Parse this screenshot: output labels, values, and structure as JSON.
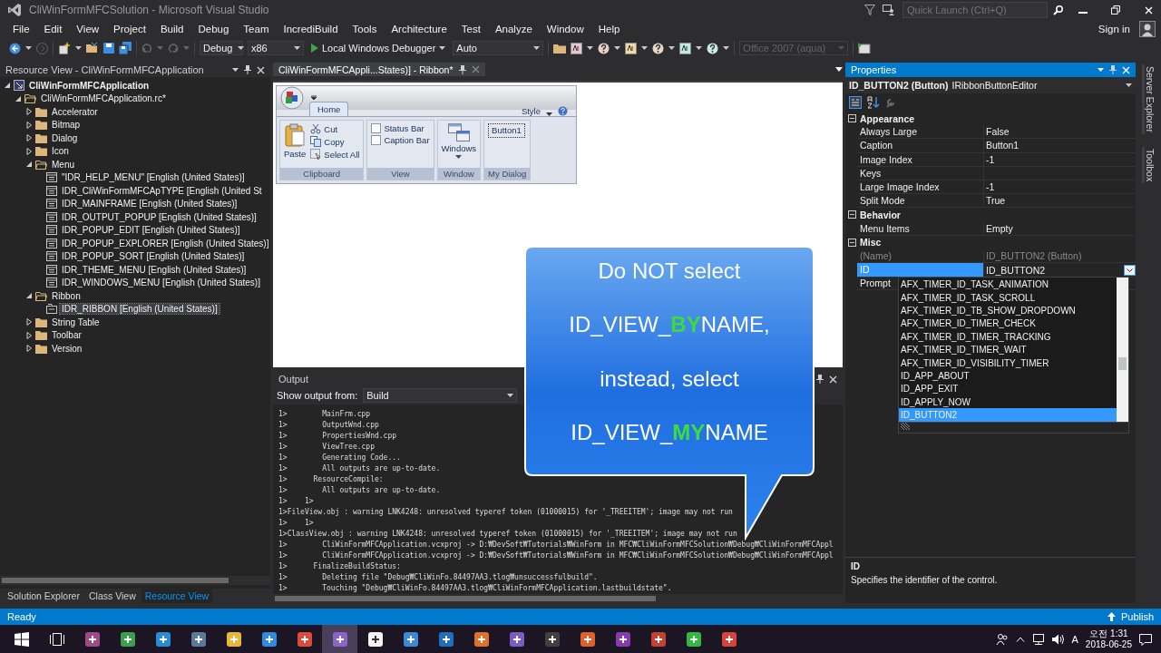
{
  "window": {
    "title": "CliWinFormMFCSolution - Microsoft Visual Studio",
    "quick_launch": {
      "placeholder": "Quick Launch (Ctrl+Q)"
    }
  },
  "menu": [
    "File",
    "Edit",
    "View",
    "Project",
    "Build",
    "Debug",
    "Team",
    "IncrediBuild",
    "Tools",
    "Architecture",
    "Test",
    "Analyze",
    "Window",
    "Help"
  ],
  "account": {
    "label": "Sign in"
  },
  "toolbar": {
    "configuration": "Debug",
    "platform": "x86",
    "debugger": "Local Windows Debugger",
    "debug_target": "Auto",
    "style": {
      "value": "Office 2007 (aqua)",
      "disabled": true
    }
  },
  "resource_view": {
    "title": "Resource View - CliWinFormMFCApplication",
    "tree": [
      {
        "label": "CliWinFormMFCApplication",
        "kind": "project",
        "expanded": true,
        "selected": false,
        "children": [
          {
            "label": "CliWinFormMFCApplication.rc*",
            "kind": "folder",
            "expanded": true,
            "selected": false,
            "children": [
              {
                "label": "Accelerator",
                "kind": "folder",
                "expanded": false,
                "selected": false
              },
              {
                "label": "Bitmap",
                "kind": "folder",
                "expanded": false,
                "selected": false
              },
              {
                "label": "Dialog",
                "kind": "folder",
                "expanded": false,
                "selected": false
              },
              {
                "label": "Icon",
                "kind": "folder",
                "expanded": false,
                "selected": false
              },
              {
                "label": "Menu",
                "kind": "folder",
                "expanded": true,
                "selected": false,
                "children": [
                  {
                    "label": "\"IDR_HELP_MENU\" [English (United States)]",
                    "kind": "menu",
                    "selected": false
                  },
                  {
                    "label": "IDR_CliWinFormMFCApTYPE [English (United St",
                    "kind": "menu",
                    "selected": false
                  },
                  {
                    "label": "IDR_MAINFRAME [English (United States)]",
                    "kind": "menu",
                    "selected": false
                  },
                  {
                    "label": "IDR_OUTPUT_POPUP [English (United States)]",
                    "kind": "menu",
                    "selected": false
                  },
                  {
                    "label": "IDR_POPUP_EDIT [English (United States)]",
                    "kind": "menu",
                    "selected": false
                  },
                  {
                    "label": "IDR_POPUP_EXPLORER [English (United States)]",
                    "kind": "menu",
                    "selected": false
                  },
                  {
                    "label": "IDR_POPUP_SORT [English (United States)]",
                    "kind": "menu",
                    "selected": false
                  },
                  {
                    "label": "IDR_THEME_MENU [English (United States)]",
                    "kind": "menu",
                    "selected": false
                  },
                  {
                    "label": "IDR_WINDOWS_MENU [English (United States)]",
                    "kind": "menu",
                    "selected": false
                  }
                ]
              },
              {
                "label": "Ribbon",
                "kind": "folder",
                "expanded": true,
                "selected": false,
                "children": [
                  {
                    "label": "IDR_RIBBON [English (United States)]",
                    "kind": "ribbon",
                    "selected": true
                  }
                ]
              },
              {
                "label": "String Table",
                "kind": "folder",
                "expanded": false,
                "selected": false
              },
              {
                "label": "Toolbar",
                "kind": "folder",
                "expanded": false,
                "selected": false
              },
              {
                "label": "Version",
                "kind": "folder",
                "expanded": false,
                "selected": false
              }
            ]
          }
        ]
      }
    ],
    "tabs": [
      {
        "label": "Solution Explorer",
        "selected": false
      },
      {
        "label": "Class View",
        "selected": false
      },
      {
        "label": "Resource View",
        "selected": true
      }
    ]
  },
  "document": {
    "tab": "CliWinFormMFCAppli...States)] - Ribbon*",
    "ribbon": {
      "tabs": [
        {
          "label": "Home",
          "selected": true
        }
      ],
      "style_menu": "Style",
      "groups": [
        {
          "label": "Clipboard",
          "items": [
            {
              "label": "Paste",
              "kind": "large"
            },
            {
              "label": "Cut",
              "kind": "small"
            },
            {
              "label": "Copy",
              "kind": "small"
            },
            {
              "label": "Select All",
              "kind": "small"
            }
          ]
        },
        {
          "label": "View",
          "items": [
            {
              "label": "Status Bar",
              "kind": "check",
              "checked": false
            },
            {
              "label": "Caption Bar",
              "kind": "check",
              "checked": false
            }
          ]
        },
        {
          "label": "Window",
          "items": [
            {
              "label": "Windows",
              "kind": "large-menu"
            }
          ]
        },
        {
          "label": "My Dialog",
          "items": [
            {
              "label": "Button1",
              "kind": "focused"
            }
          ]
        }
      ]
    }
  },
  "output": {
    "title": "Output",
    "source_label": "Show output from:",
    "source": "Build",
    "lines": [
      "1>        MainFrm.cpp",
      "1>        OutputWnd.cpp",
      "1>        PropertiesWnd.cpp",
      "1>        ViewTree.cpp",
      "1>        Generating Code...",
      "1>        All outputs are up-to-date.",
      "1>      ResourceCompile:",
      "1>        All outputs are up-to-date.",
      "1>    1>",
      "1>FileView.obj : warning LNK4248: unresolved typeref token (01000015) for '_TREEITEM'; image may not run",
      "1>    1>",
      "1>ClassView.obj : warning LNK4248: unresolved typeref token (01000015) for '_TREEITEM'; image may not run",
      "1>        CliWinFormMFCApplication.vcxproj -> D:₩DevSoft₩Tutorials₩WinForm in MFC₩CliWinFormMFCSolution₩Debug₩CliWinFormMFCAppl",
      "1>        CliWinFormMFCApplication.vcxproj -> D:₩DevSoft₩Tutorials₩WinForm in MFC₩CliWinFormMFCSolution₩Debug₩CliWinFormMFCAppl",
      "1>      FinalizeBuildStatus:",
      "1>        Deleting file \"Debug₩CliWinFo.84497AA3.tlog₩unsuccessfulbuild\".",
      "1>        Touching \"Debug₩CliWinFo.84497AA3.tlog₩CliWinFormMFCApplication.lastbuildstate\"."
    ]
  },
  "callout": {
    "lines": [
      [
        {
          "text": "Do NOT select",
          "highlight": false
        }
      ],
      [
        {
          "text": "ID_VIEW_",
          "highlight": false
        },
        {
          "text": "BY",
          "highlight": true
        },
        {
          "text": "NAME,",
          "highlight": false
        }
      ],
      [
        {
          "text": "instead, select",
          "highlight": false
        }
      ],
      [
        {
          "text": "ID_VIEW_",
          "highlight": false
        },
        {
          "text": "MY",
          "highlight": true
        },
        {
          "text": "NAME",
          "highlight": false
        }
      ]
    ]
  },
  "properties": {
    "title": "Properties",
    "object": {
      "name": "ID_BUTTON2 (Button)",
      "type": "IRibbonButtonEditor"
    },
    "categories": [
      {
        "label": "Appearance",
        "expanded": true,
        "rows": [
          {
            "name": "Always Large",
            "value": "False",
            "selected": false,
            "readonly": false
          },
          {
            "name": "Caption",
            "value": "Button1",
            "selected": false,
            "readonly": false
          },
          {
            "name": "Image Index",
            "value": "-1",
            "selected": false,
            "readonly": false
          },
          {
            "name": "Keys",
            "selected": false,
            "readonly": false
          },
          {
            "name": "Large Image Index",
            "value": "-1",
            "selected": false,
            "readonly": false
          },
          {
            "name": "Split Mode",
            "value": "True",
            "selected": false,
            "readonly": false
          }
        ]
      },
      {
        "label": "Behavior",
        "expanded": true,
        "rows": [
          {
            "name": "Menu Items",
            "value": "Empty",
            "selected": false,
            "readonly": false
          }
        ]
      },
      {
        "label": "Misc",
        "expanded": true,
        "rows": [
          {
            "name": "(Name)",
            "value": "ID_BUTTON2 (Button)",
            "selected": false,
            "readonly": true
          },
          {
            "name": "ID",
            "value": "ID_BUTTON2",
            "selected": true,
            "readonly": false
          },
          {
            "name": "Prompt",
            "selected": false,
            "readonly": false
          }
        ]
      }
    ],
    "id_list": [
      {
        "label": "AFX_TIMER_ID_TASK_ANIMATION",
        "selected": false
      },
      {
        "label": "AFX_TIMER_ID_TASK_SCROLL",
        "selected": false
      },
      {
        "label": "AFX_TIMER_ID_TB_SHOW_DROPDOWN",
        "selected": false
      },
      {
        "label": "AFX_TIMER_ID_TIMER_CHECK",
        "selected": false
      },
      {
        "label": "AFX_TIMER_ID_TIMER_TRACKING",
        "selected": false
      },
      {
        "label": "AFX_TIMER_ID_TIMER_WAIT",
        "selected": false
      },
      {
        "label": "AFX_TIMER_ID_VISIBILITY_TIMER",
        "selected": false
      },
      {
        "label": "ID_APP_ABOUT",
        "selected": false
      },
      {
        "label": "ID_APP_EXIT",
        "selected": false
      },
      {
        "label": "ID_APPLY_NOW",
        "selected": false
      },
      {
        "label": "ID_BUTTON2",
        "selected": true
      }
    ],
    "description": {
      "title": "ID",
      "text": "Specifies the identifier of the control."
    }
  },
  "side_tabs": [
    "Server Explorer",
    "Toolbox"
  ],
  "status_bar": {
    "text": "Ready",
    "publish": "Publish"
  },
  "taskbar": {
    "apps": [
      {
        "selected": false
      },
      {
        "selected": false
      },
      {
        "selected": false
      },
      {
        "selected": false
      },
      {
        "selected": false
      },
      {
        "selected": false
      },
      {
        "selected": false
      },
      {
        "selected": true
      },
      {
        "selected": false
      },
      {
        "selected": false
      },
      {
        "selected": false
      },
      {
        "selected": false
      },
      {
        "selected": false
      },
      {
        "selected": false
      },
      {
        "selected": false
      },
      {
        "selected": false
      },
      {
        "selected": false
      },
      {
        "selected": false
      },
      {
        "selected": false
      }
    ],
    "ime": "A",
    "time": "오전 1:31",
    "date": "2018-06-25"
  }
}
